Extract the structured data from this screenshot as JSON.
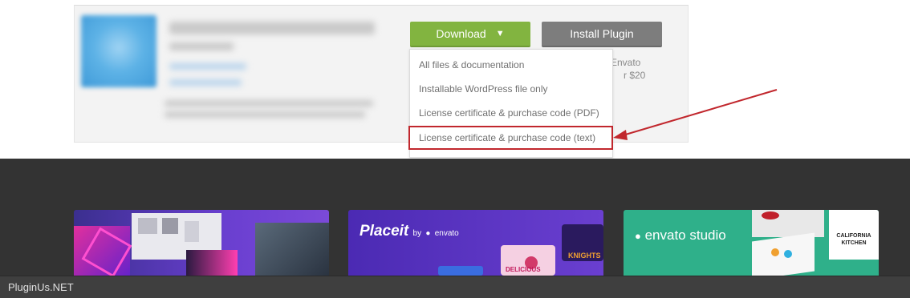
{
  "item": {
    "download_label": "Download",
    "download_caret": "▼",
    "install_label": "Install Plugin",
    "side_text_1": "Envato",
    "side_text_2": "r $20"
  },
  "dropdown": {
    "items": [
      {
        "label": "All files & documentation"
      },
      {
        "label": "Installable WordPress file only"
      },
      {
        "label": "License certificate & purchase code (PDF)"
      },
      {
        "label": "License certificate & purchase code (text)"
      }
    ],
    "highlighted_index": 3
  },
  "promos": {
    "placeit_logo": "Placeit",
    "placeit_by": "by",
    "placeit_envato": "envato",
    "studio_logo": "envato studio",
    "kitchen_text": "CALIFORNIA KITCHEN",
    "knights_text": "KNIGHTS",
    "delicious_text": "DELICIOUS"
  },
  "watermark": "PluginUs.NET",
  "colors": {
    "download_green": "#82b440",
    "install_gray": "#7d7d7d",
    "highlight_red": "#c1272d",
    "footer_bg": "#333333"
  },
  "icons": [
    "dropdown-caret-icon",
    "annotation-arrow-icon",
    "envato-leaf-icon"
  ]
}
